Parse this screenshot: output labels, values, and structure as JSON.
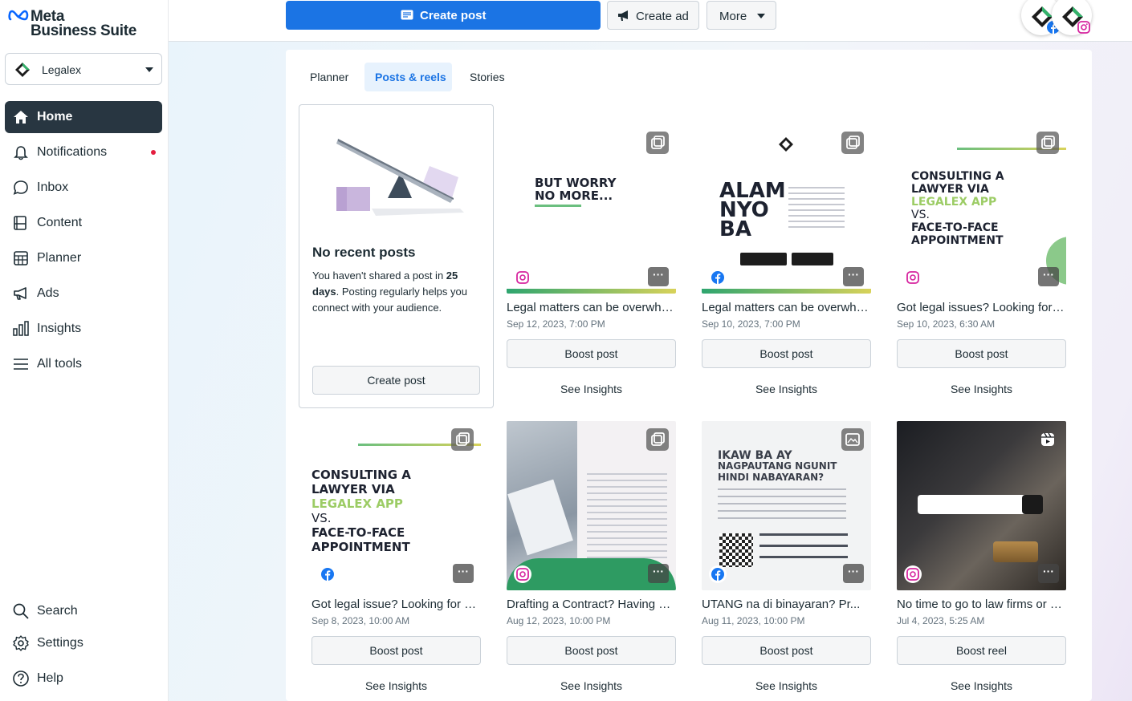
{
  "brand": {
    "line1": "Meta",
    "line2": "Business Suite"
  },
  "account": {
    "name": "Legalex",
    "icon": "legalex-diamond-icon"
  },
  "sidebar": {
    "items": [
      {
        "label": "Home",
        "icon": "home-icon",
        "active": true
      },
      {
        "label": "Notifications",
        "icon": "bell-icon",
        "has_dot": true
      },
      {
        "label": "Inbox",
        "icon": "chat-bubble-icon"
      },
      {
        "label": "Content",
        "icon": "content-icon"
      },
      {
        "label": "Planner",
        "icon": "calendar-grid-icon"
      },
      {
        "label": "Ads",
        "icon": "megaphone-icon"
      },
      {
        "label": "Insights",
        "icon": "bar-chart-icon"
      },
      {
        "label": "All tools",
        "icon": "hamburger-icon"
      }
    ],
    "bottom": [
      {
        "label": "Search",
        "icon": "search-icon"
      },
      {
        "label": "Settings",
        "icon": "gear-icon"
      },
      {
        "label": "Help",
        "icon": "question-icon"
      }
    ]
  },
  "toolbar": {
    "create_post": "Create post",
    "create_ad": "Create ad",
    "more": "More"
  },
  "tabs": [
    {
      "label": "Planner"
    },
    {
      "label": "Posts & reels",
      "active": true
    },
    {
      "label": "Stories"
    }
  ],
  "empty_state": {
    "title": "No recent posts",
    "desc_before": "You haven't shared a post in ",
    "days": "25 days",
    "desc_after": ". Posting regularly helps you connect with your audience.",
    "button": "Create post"
  },
  "posts": [
    {
      "caption": "Legal matters can be overwhelming...",
      "date": "Sep 12, 2023, 7:00 PM",
      "platform": "instagram",
      "type": "carousel",
      "action": "Boost post",
      "insights": "See Insights",
      "thumb_text": [
        "BUT WORRY",
        "NO MORE..."
      ]
    },
    {
      "caption": "Legal matters can be overwhelming...",
      "date": "Sep 10, 2023, 7:00 PM",
      "platform": "facebook",
      "type": "carousel",
      "action": "Boost post",
      "insights": "See Insights",
      "thumb_text": [
        "ALAM",
        "NYO",
        "BA"
      ]
    },
    {
      "caption": "Got legal issues? Looking for a lawyer...",
      "date": "Sep 10, 2023, 6:30 AM",
      "platform": "instagram",
      "type": "carousel",
      "action": "Boost post",
      "insights": "See Insights",
      "thumb_text": [
        "CONSULTING A",
        "LAWYER VIA",
        "LEGALEX APP",
        "VS.",
        "FACE-TO-FACE",
        "APPOINTMENT"
      ]
    },
    {
      "caption": "Got legal issue? Looking for a lawyer...",
      "date": "Sep 8, 2023, 10:00 AM",
      "platform": "facebook",
      "type": "carousel",
      "action": "Boost post",
      "insights": "See Insights",
      "thumb_text": [
        "CONSULTING A",
        "LAWYER VIA",
        "LEGALEX APP",
        "VS.",
        "FACE-TO-FACE",
        "APPOINTMENT"
      ]
    },
    {
      "caption": "Drafting a Contract? Having a lawyer...",
      "date": "Aug 12, 2023, 10:00 PM",
      "platform": "instagram",
      "type": "carousel",
      "action": "Boost post",
      "insights": "See Insights",
      "thumb_text": []
    },
    {
      "caption": "UTANG na di binayaran? Pr...",
      "date": "Aug 11, 2023, 10:00 PM",
      "platform": "facebook",
      "type": "photo",
      "action": "Boost post",
      "insights": "See Insights",
      "thumb_text": [
        "IKAW BA AY",
        "NAGPAUTANG NGUNIT",
        "HINDI NABAYARAN?"
      ]
    },
    {
      "caption": "No time to go to law firms or offices?",
      "date": "Jul 4, 2023, 5:25 AM",
      "platform": "instagram",
      "type": "reel",
      "action": "Boost reel",
      "insights": "See Insights",
      "thumb_text": []
    }
  ],
  "colors": {
    "primary": "#1b74e4",
    "sidebar_active": "#283641",
    "notification_dot": "#e41e3f"
  }
}
